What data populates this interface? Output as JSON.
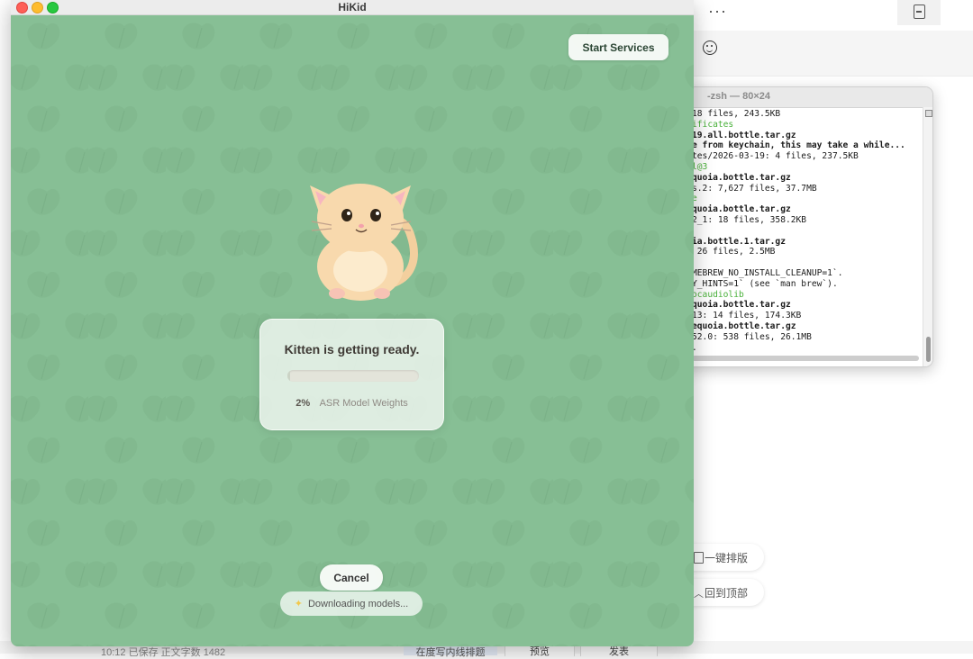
{
  "hikid": {
    "title": "HiKid",
    "start_services": "Start Services",
    "status_title": "Kitten is getting ready.",
    "progress": {
      "percent": 2,
      "percent_label": "2%",
      "label": "ASR Model Weights"
    },
    "cancel": "Cancel",
    "downloading": "Downloading models...",
    "colors": {
      "background": "#87bf95",
      "leaf": "#7db58a",
      "accent": "#2b4634"
    }
  },
  "terminal": {
    "title": "-zsh — 80×24",
    "lines": [
      {
        "text": "18 files, 243.5KB",
        "style": ""
      },
      {
        "text": "ificates",
        "style": "g"
      },
      {
        "text": "19.all.bottle.tar.gz",
        "style": "b"
      },
      {
        "text": "e from keychain, this may take a while...",
        "style": "b"
      },
      {
        "text": "tes/2026-03-19: 4 files, 237.5KB",
        "style": ""
      },
      {
        "text": "l@3",
        "style": "g"
      },
      {
        "text": "quoia.bottle.tar.gz",
        "style": "b"
      },
      {
        "text": "s.2: 7,627 files, 37.7MB",
        "style": ""
      },
      {
        "text": "e",
        "style": "g"
      },
      {
        "text": "quoia.bottle.tar.gz",
        "style": "b"
      },
      {
        "text": "2_1: 18 files, 358.2KB",
        "style": ""
      },
      {
        "text": "",
        "style": ""
      },
      {
        "text": "ia.bottle.1.tar.gz",
        "style": "b"
      },
      {
        "text": " 26 files, 2.5MB",
        "style": ""
      },
      {
        "text": "",
        "style": ""
      },
      {
        "text": "MEBREW_NO_INSTALL_CLEANUP=1`.",
        "style": ""
      },
      {
        "text": "Y_HINTS=1` (see `man brew`).",
        "style": ""
      },
      {
        "text": "ocaudiolib",
        "style": "g"
      },
      {
        "text": "quoia.bottle.tar.gz",
        "style": "b"
      },
      {
        "text": "13: 14 files, 174.3KB",
        "style": ""
      },
      {
        "text": "equoia.bottle.tar.gz",
        "style": "b"
      },
      {
        "text": "52.0: 538 files, 26.1MB",
        "style": ""
      },
      {
        "text": ".",
        "style": ""
      }
    ]
  },
  "editor": {
    "more_label": "···",
    "one_click_layout": "一键排版",
    "back_to_top": "回到顶部",
    "status_left": "10:12  已保存    正文字数  1482",
    "tab_active": "在度写内线排题",
    "preview": "预览",
    "publish": "发表"
  }
}
